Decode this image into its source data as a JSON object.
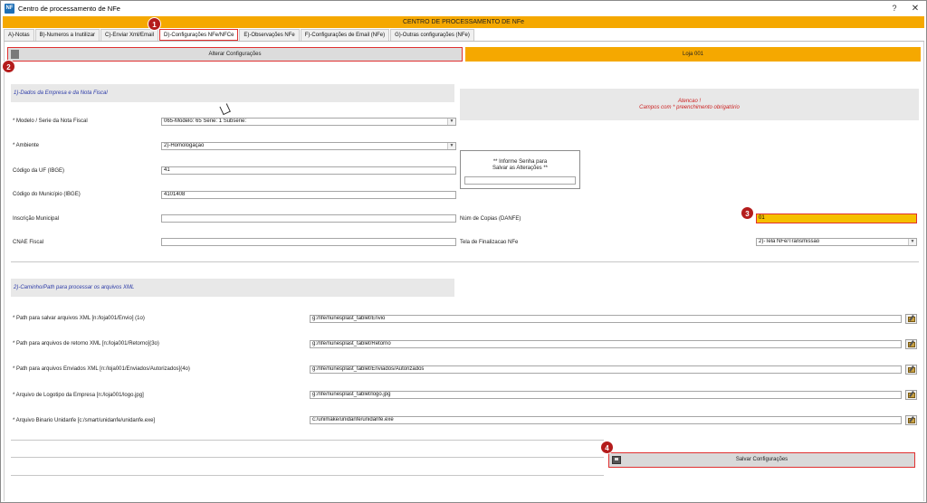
{
  "window": {
    "title": "Centro de processamento de NFe",
    "help": "?",
    "close": "✕"
  },
  "header": {
    "title": "CENTRO DE PROCESSAMENTO DE NFe"
  },
  "tabs": [
    {
      "label": "A)-Notas"
    },
    {
      "label": "B)-Numeros a Inutilizar"
    },
    {
      "label": "C)-Enviar Xml/Email"
    },
    {
      "label": "D)-Configurações NFe/NFCe"
    },
    {
      "label": "E)-Observações NFe"
    },
    {
      "label": "F)-Configurações de Email (NFe)"
    },
    {
      "label": "G)-Outras configurações (NFe)"
    }
  ],
  "toolbar": {
    "alterar_label": "Alterar Configurações",
    "loja_label": "Loja 001"
  },
  "section1": {
    "title": "1)-Dados da Empresa e da Nota Fiscal"
  },
  "atencao": {
    "line1": "Atencao !",
    "line2": "Campos com * preenchimento obrigatório"
  },
  "form": {
    "modelo": {
      "label": "* Modelo / Serie da Nota Fiscal",
      "value": "065-Modelo: 65 Serie: 1 Subserie:"
    },
    "ambiente": {
      "label": "* Ambiente",
      "value": "2)-Homologação"
    },
    "uf": {
      "label": "Código da UF (IBGE)",
      "value": "41"
    },
    "municipio": {
      "label": "Código do Município (IBGE)",
      "value": "4101408"
    },
    "inscricao": {
      "label": "Inscrição Municipal",
      "value": ""
    },
    "cnae": {
      "label": "CNAE Fiscal",
      "value": ""
    },
    "copias": {
      "label": "Núm de Copias (DANFE)",
      "value": "01"
    },
    "tela": {
      "label": "Tela de Finalizacao NFe",
      "value": "2)-Tela NFe/Transmissão"
    }
  },
  "senha": {
    "line1": "** Informe Senha para",
    "line2": "Salvar as Alterações **",
    "value": ""
  },
  "section2": {
    "title": "2)-Caminho/Path para processar os arquivos XML"
  },
  "paths": [
    {
      "label": "* Path para salvar arquivos XML [n:/loja001/Envio] (1o)",
      "value": "g:/nfe/nunesplast_tablet/Envio"
    },
    {
      "label": "* Path para arquivos de retorno XML [n:/loja001/Retorno](3o)",
      "value": "g:/nfe/nunesplast_tablet/Retorno"
    },
    {
      "label": "* Path para arquivos Enviados XML [n:/loja001/Enviados/Autorizados](4o)",
      "value": "g:/nfe/nunesplast_tablet/Enviados/Autorizados"
    },
    {
      "label": "* Arquivo de Logotipo da Empresa [n:/loja001/logo.jpg]",
      "value": "g:/nfe/nunesplast_tablet/logo.jpg"
    },
    {
      "label": "* Arquivo Binario Unidanfe [c:/smart/unidanfe/unidanfe.exe]",
      "value": "c:/unimake/unidanfe/unidanfe.exe"
    }
  ],
  "save": {
    "label": "Salvar  Configurações"
  },
  "badges": [
    "1",
    "2",
    "3",
    "4"
  ],
  "colors": {
    "accent": "#f5a800",
    "highlight": "#e03030",
    "badge": "#b41c1c",
    "section_text": "#2b3aa7"
  },
  "icons": {
    "folder": "folder-edit-icon",
    "disk": "floppy-disk-icon",
    "app": "app-icon"
  }
}
